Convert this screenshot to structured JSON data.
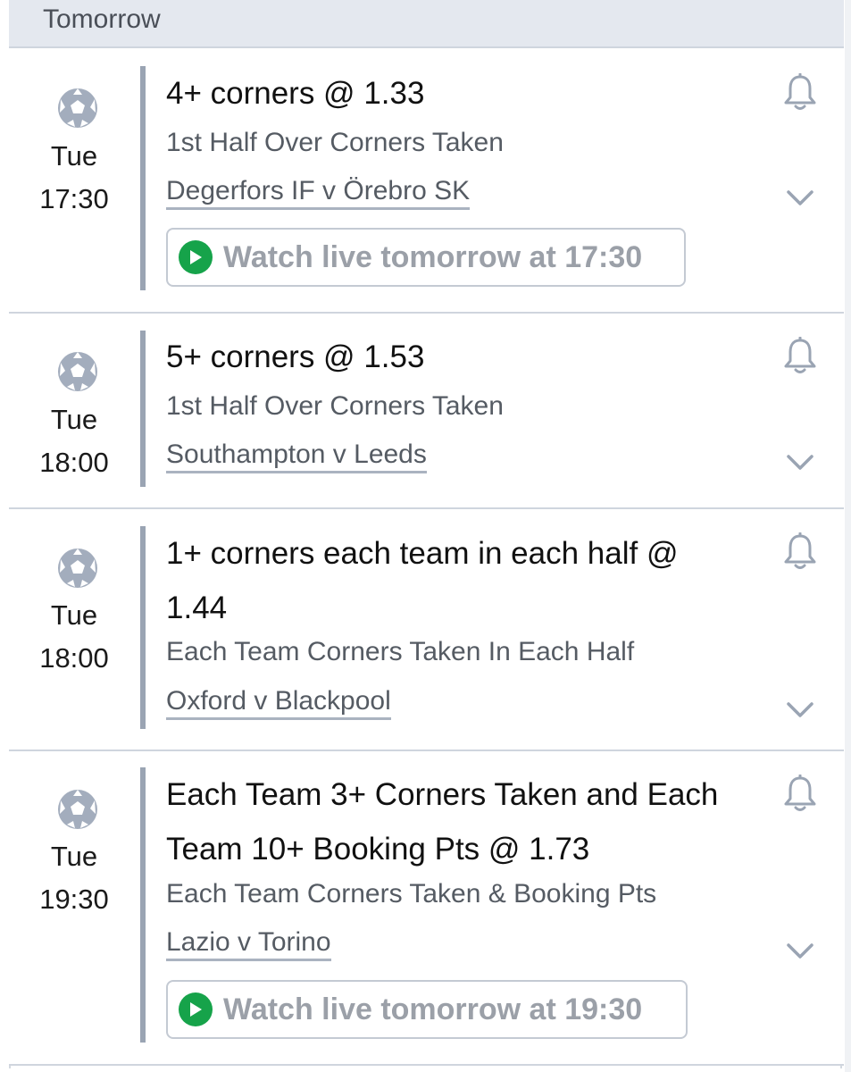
{
  "section": {
    "title": "Tomorrow"
  },
  "colors": {
    "accent_bar": "#9aa4b3",
    "play_green": "#16a34a",
    "header_bg": "#e4e8ef"
  },
  "icons": {
    "sport": "football-icon",
    "alert": "bell-icon",
    "expand": "chevron-down-icon",
    "stream": "play-icon"
  },
  "bets": [
    {
      "day": "Tue",
      "time": "17:30",
      "title": "4+ corners @ 1.33",
      "market": "1st Half Over Corners Taken",
      "match": "Degerfors IF v Örebro SK",
      "watch": "Watch live tomorrow at 17:30"
    },
    {
      "day": "Tue",
      "time": "18:00",
      "title": "5+ corners @ 1.53",
      "market": "1st Half Over Corners Taken",
      "match": "Southampton v Leeds"
    },
    {
      "day": "Tue",
      "time": "18:00",
      "title": "1+ corners each team in each half @ 1.44",
      "market": "Each Team Corners Taken In Each Half",
      "match": "Oxford v Blackpool"
    },
    {
      "day": "Tue",
      "time": "19:30",
      "title": "Each Team 3+ Corners Taken and Each Team 10+ Booking Pts @ 1.73",
      "market": "Each Team Corners Taken & Booking Pts",
      "match": "Lazio v Torino",
      "watch": "Watch live tomorrow at 19:30"
    }
  ]
}
